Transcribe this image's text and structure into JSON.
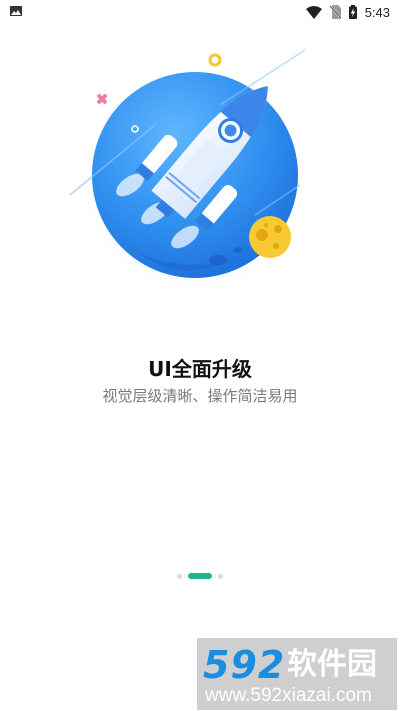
{
  "status_bar": {
    "time": "5:43",
    "icons": [
      "image-notification-icon",
      "wifi-icon",
      "no-sim-icon",
      "battery-charging-icon"
    ]
  },
  "onboarding": {
    "title": "UI全面升级",
    "subtitle": "视觉层级清晰、操作简洁易用",
    "page_count": 3,
    "active_page": 2,
    "accent_color": "#1fb68e"
  },
  "watermark": {
    "logo": "592",
    "text": "软件园",
    "url": "www.592xiazai.com"
  }
}
